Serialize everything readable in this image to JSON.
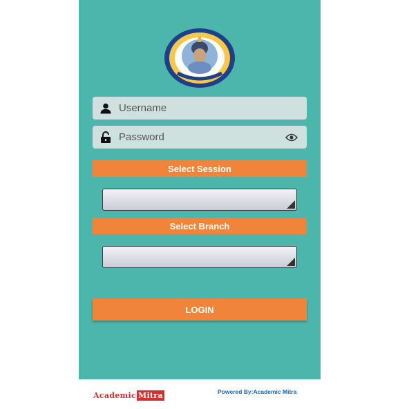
{
  "login_form": {
    "username_placeholder": "Username",
    "password_placeholder": "Password",
    "session_label": "Select Session",
    "session_value": "",
    "branch_label": "Select Branch",
    "branch_value": "",
    "login_label": "LOGIN"
  },
  "footer": {
    "brand_part1": "Academic",
    "brand_part2": "Mitra",
    "powered_by": "Powered By:Academic Mitra"
  },
  "colors": {
    "background": "#4db6ac",
    "accent": "#f0843a",
    "field": "#cfe1de",
    "brand_red": "#d32f2f",
    "link_blue": "#1565c0"
  },
  "icons": {
    "username": "user-icon",
    "password": "lock-icon",
    "toggle": "eye-icon",
    "dropdown": "dropdown-corner-icon"
  }
}
